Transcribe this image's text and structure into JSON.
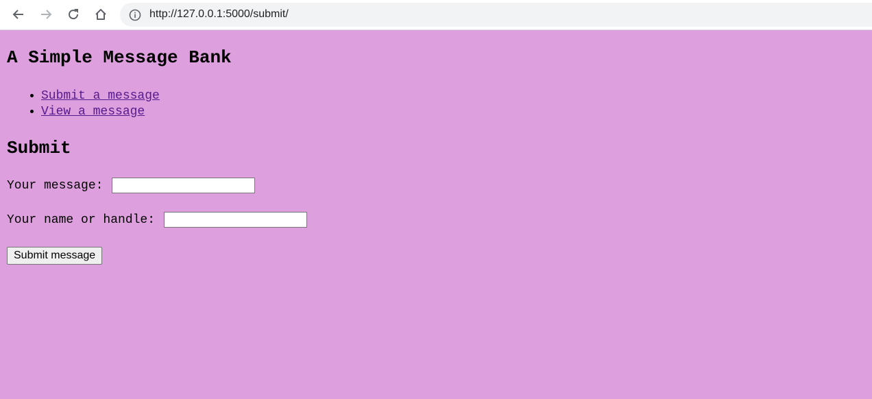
{
  "browser": {
    "url": "http://127.0.0.1:5000/submit/",
    "icons": {
      "back": "arrow-left-icon",
      "forward": "arrow-right-icon",
      "reload": "reload-icon",
      "home": "home-icon",
      "info": "info-icon"
    }
  },
  "page": {
    "background_color": "#dd9fdd",
    "title": "A Simple Message Bank",
    "nav_links": [
      {
        "label": "Submit a message"
      },
      {
        "label": "View a message"
      }
    ],
    "section_heading": "Submit",
    "form": {
      "message_label": "Your message:",
      "message_value": "",
      "name_label": "Your name or handle:",
      "name_value": "",
      "submit_label": "Submit message"
    }
  }
}
